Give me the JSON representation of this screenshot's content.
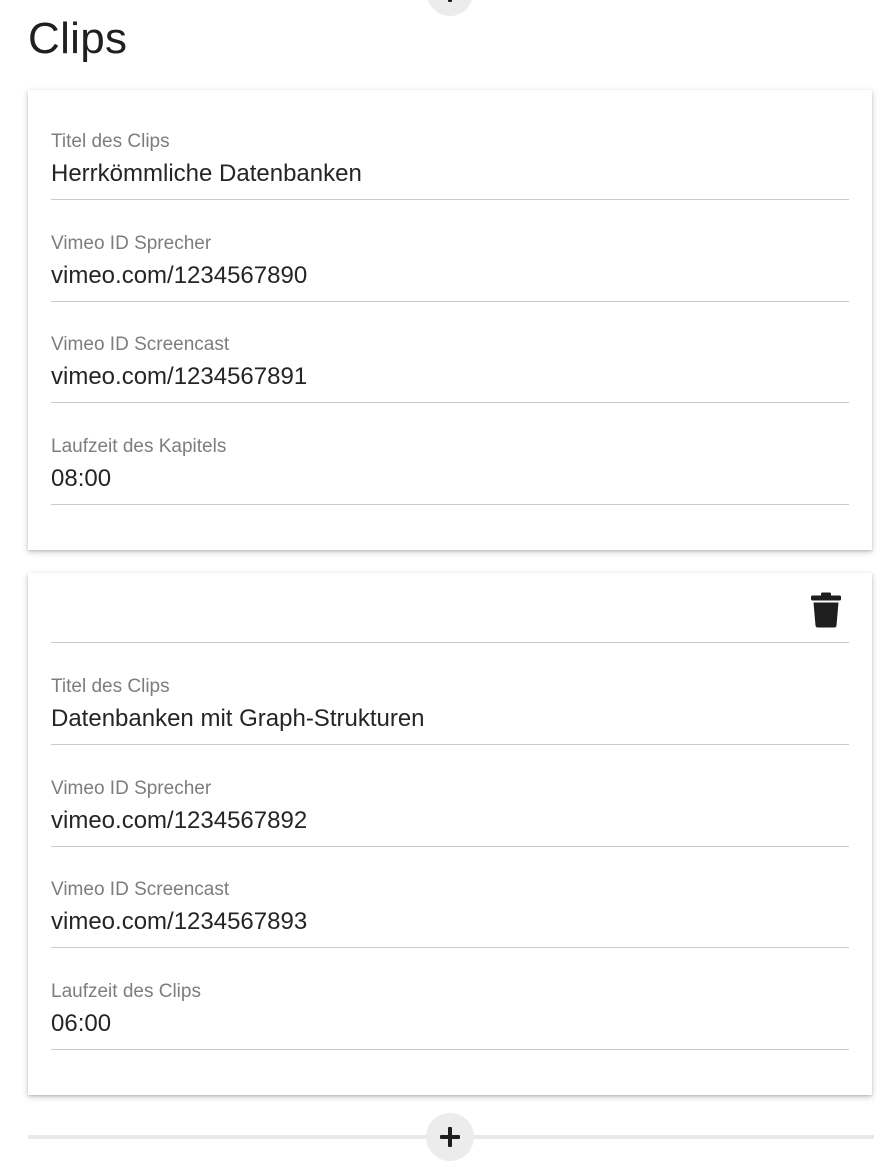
{
  "section": {
    "title": "Clips"
  },
  "clips": [
    {
      "fields": [
        {
          "label": "Titel des Clips",
          "value": "Herrkömmliche Datenbanken"
        },
        {
          "label": "Vimeo ID Sprecher",
          "value": "vimeo.com/1234567890"
        },
        {
          "label": "Vimeo ID Screencast",
          "value": "vimeo.com/1234567891"
        },
        {
          "label": "Laufzeit des Kapitels",
          "value": "08:00"
        }
      ]
    },
    {
      "delete_icon": "trash-icon",
      "fields": [
        {
          "label": "Titel des Clips",
          "value": "Datenbanken mit Graph-Strukturen"
        },
        {
          "label": "Vimeo ID Sprecher",
          "value": "vimeo.com/1234567892"
        },
        {
          "label": "Vimeo ID Screencast",
          "value": "vimeo.com/1234567893"
        },
        {
          "label": "Laufzeit des Clips",
          "value": "06:00"
        }
      ]
    }
  ],
  "icons": {
    "add": "plus-icon",
    "delete": "trash-icon"
  },
  "colors": {
    "label": "#7d7d7d",
    "value": "#252525",
    "divider": "#c9c9c9",
    "button_bg": "#ececec",
    "icon": "#1e1e1e"
  }
}
